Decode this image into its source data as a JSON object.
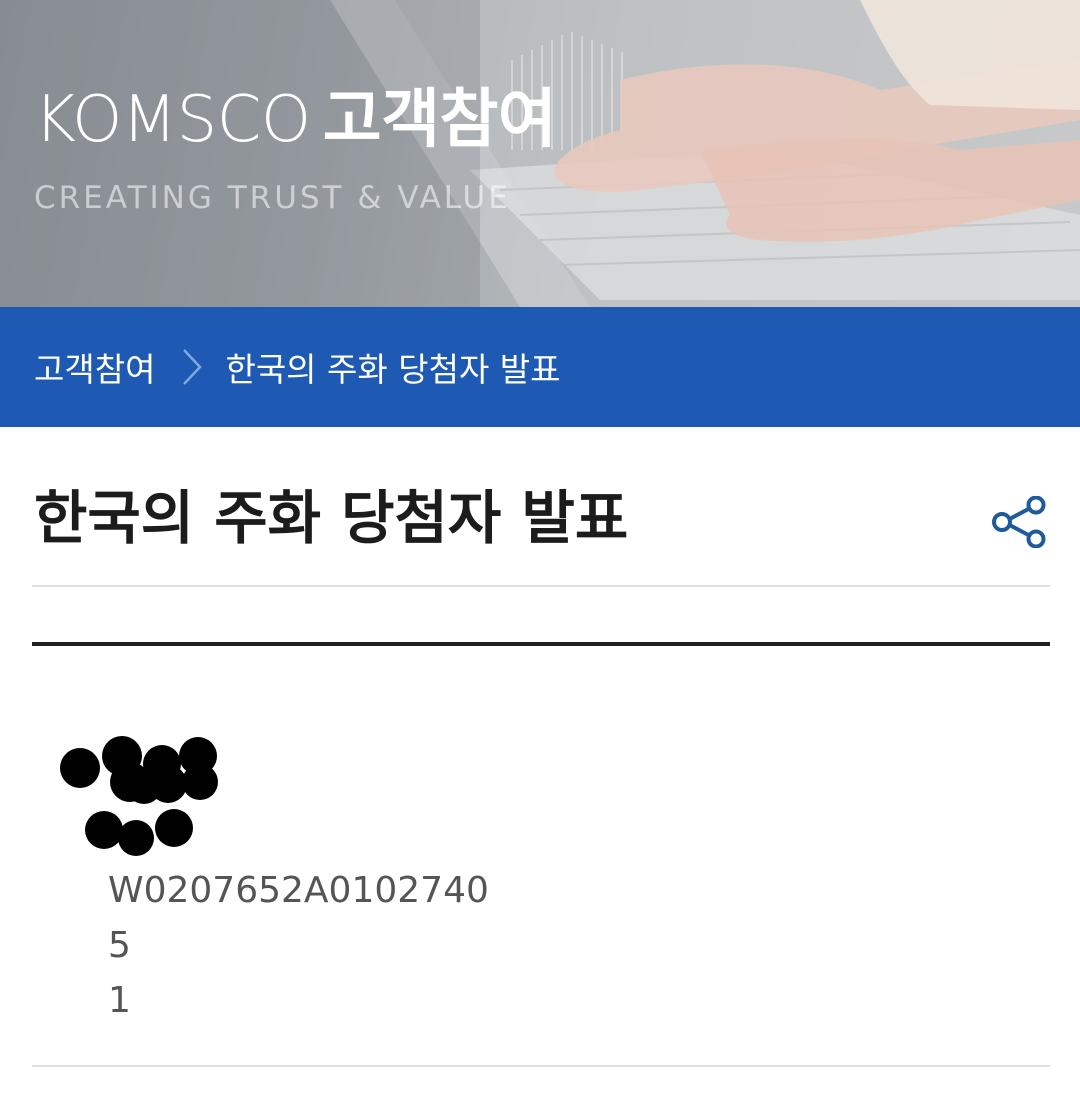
{
  "hero": {
    "brand": "KOMSCO",
    "title": "고객참여",
    "subtitle": "CREATING TRUST & VALUE"
  },
  "breadcrumb": {
    "parent": "고객참여",
    "current": "한국의 주화 당첨자 발표"
  },
  "page": {
    "title": "한국의 주화 당첨자 발표",
    "share_icon": "share-icon"
  },
  "entry": {
    "code": "W0207652A0102740",
    "line2": "5",
    "line3": "1"
  }
}
